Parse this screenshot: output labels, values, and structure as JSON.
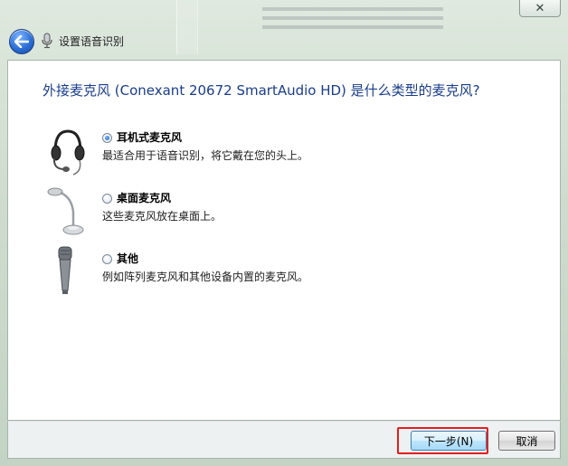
{
  "window": {
    "title": "设置语音识别",
    "close_glyph": "✕"
  },
  "main": {
    "heading": "外接麦克风 (Conexant 20672 SmartAudio HD) 是什么类型的麦克风?",
    "options": [
      {
        "label": "耳机式麦克风",
        "description": "最适合用于语音识别，将它戴在您的头上。",
        "selected": true,
        "icon": "headset-microphone-icon"
      },
      {
        "label": "桌面麦克风",
        "description": "这些麦克风放在桌面上。",
        "selected": false,
        "icon": "desktop-microphone-icon"
      },
      {
        "label": "其他",
        "description": "例如阵列麦克风和其他设备内置的麦克风。",
        "selected": false,
        "icon": "handheld-microphone-icon"
      }
    ]
  },
  "footer": {
    "next_label": "下一步(N)",
    "cancel_label": "取消"
  },
  "colors": {
    "heading": "#1a3c8c",
    "highlight": "#e31f1f"
  }
}
